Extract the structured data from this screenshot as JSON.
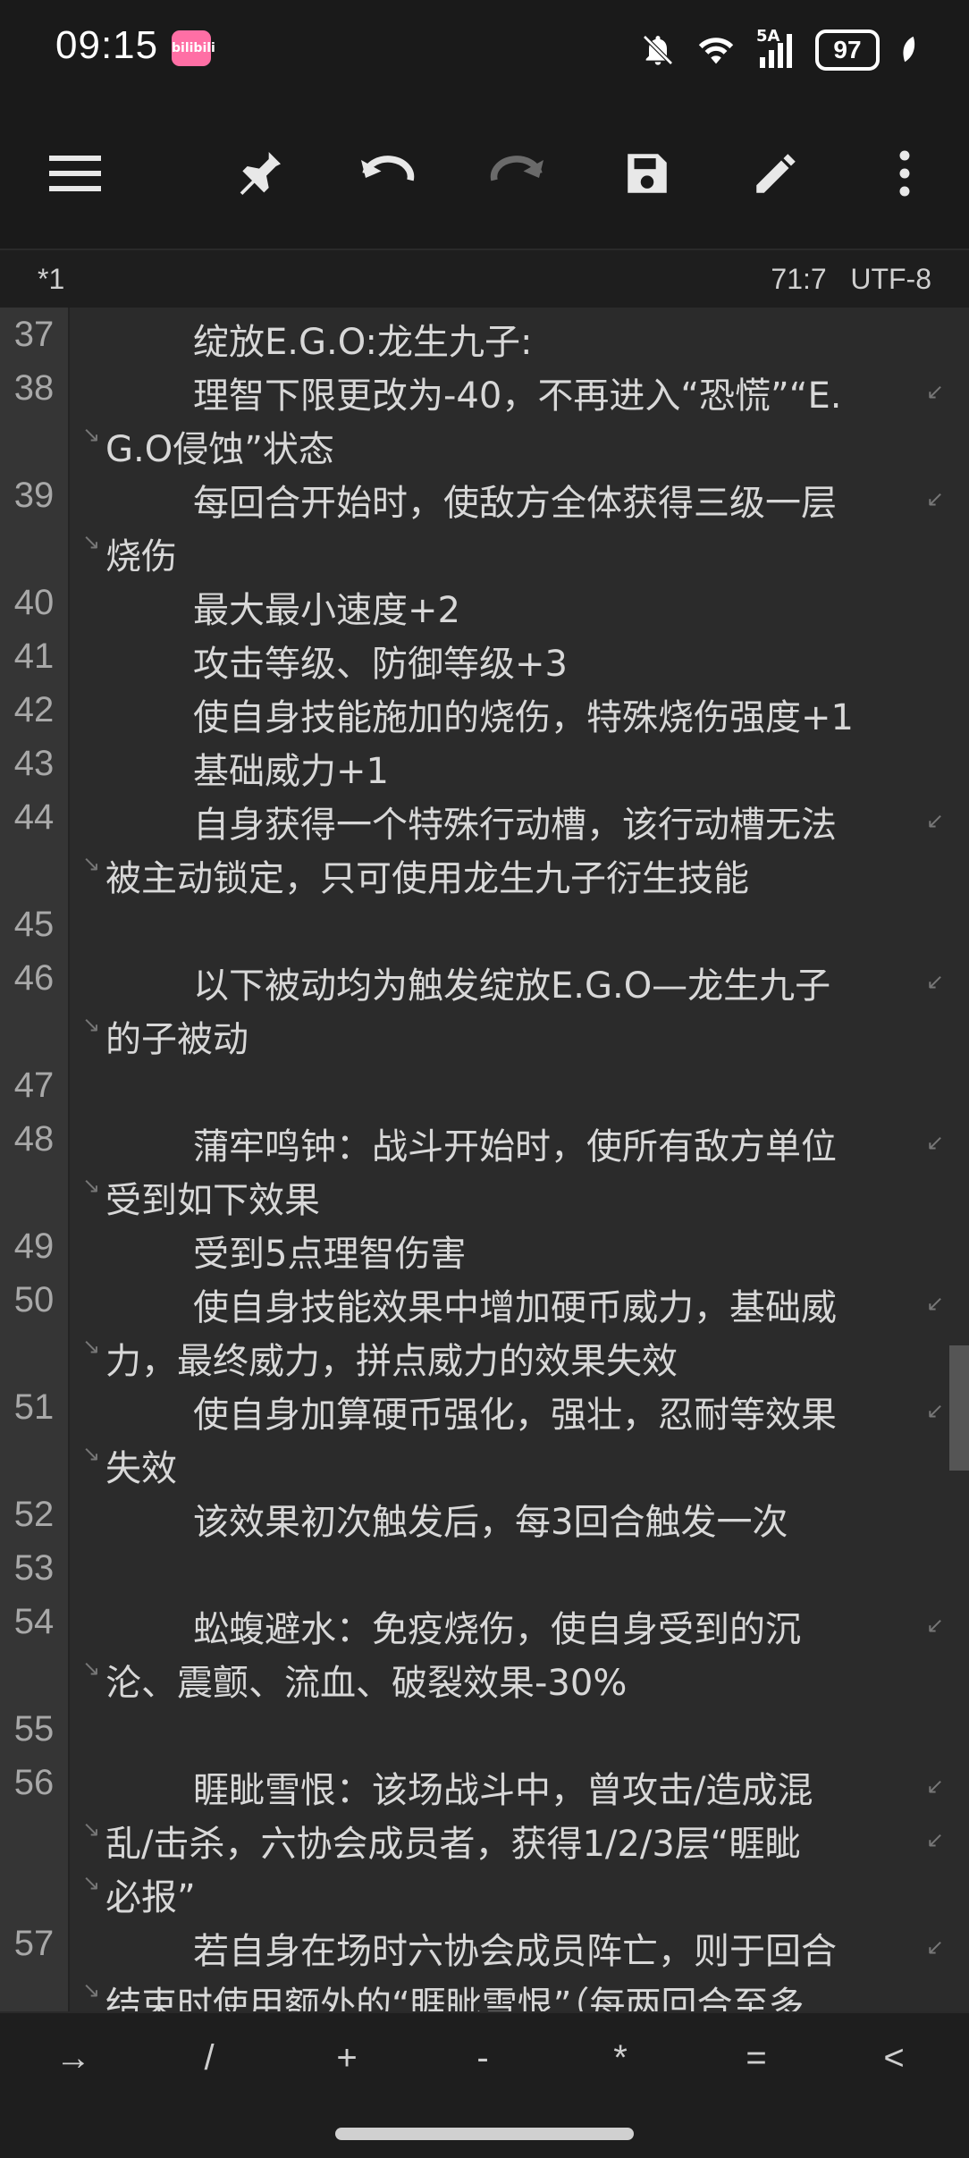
{
  "status_bar": {
    "time": "09:15",
    "app_badge": "bilibili",
    "network": "5A",
    "battery": "97"
  },
  "info_bar": {
    "file_name": "*1",
    "cursor_position": "71:7",
    "encoding": "UTF-8"
  },
  "editor_lines": [
    {
      "num": "37",
      "parts": [
        "绽放E.G.O:龙生九子:"
      ]
    },
    {
      "num": "38",
      "parts": [
        "理智下限更改为-40，不再进入“恐慌”“E.",
        "G.O侵蚀”状态"
      ]
    },
    {
      "num": "39",
      "parts": [
        "每回合开始时，使敌方全体获得三级一层",
        "烧伤"
      ]
    },
    {
      "num": "40",
      "parts": [
        "最大最小速度+2"
      ]
    },
    {
      "num": "41",
      "parts": [
        "攻击等级、防御等级+3"
      ]
    },
    {
      "num": "42",
      "parts": [
        "使自身技能施加的烧伤，特殊烧伤强度+1"
      ]
    },
    {
      "num": "43",
      "parts": [
        "基础威力+1"
      ]
    },
    {
      "num": "44",
      "parts": [
        "自身获得一个特殊行动槽，该行动槽无法",
        "被主动锁定，只可使用龙生九子衍生技能"
      ]
    },
    {
      "num": "45",
      "parts": [
        ""
      ]
    },
    {
      "num": "46",
      "parts": [
        "以下被动均为触发绽放E.G.O—龙生九子",
        "的子被动"
      ]
    },
    {
      "num": "47",
      "parts": [
        ""
      ]
    },
    {
      "num": "48",
      "parts": [
        "蒲牢鸣钟：战斗开始时，使所有敌方单位",
        "受到如下效果"
      ]
    },
    {
      "num": "49",
      "parts": [
        "受到5点理智伤害"
      ]
    },
    {
      "num": "50",
      "parts": [
        "使自身技能效果中增加硬币威力，基础威",
        "力，最终威力，拼点威力的效果失效"
      ]
    },
    {
      "num": "51",
      "parts": [
        "使自身加算硬币强化，强壮，忍耐等效果",
        "失效"
      ]
    },
    {
      "num": "52",
      "parts": [
        "该效果初次触发后，每3回合触发一次"
      ]
    },
    {
      "num": "53",
      "parts": [
        ""
      ]
    },
    {
      "num": "54",
      "parts": [
        "蚣蝮避水：免疫烧伤，使自身受到的沉",
        "沦、震颤、流血、破裂效果-30%"
      ]
    },
    {
      "num": "55",
      "parts": [
        ""
      ]
    },
    {
      "num": "56",
      "parts": [
        "睚眦雪恨：该场战斗中，曾攻击/造成混",
        "乱/击杀，六协会成员者，获得1/2/3层“睚眦",
        "必报”"
      ]
    },
    {
      "num": "57",
      "parts": [
        "若自身在场时六协会成员阵亡，则于回合",
        "结束时使用额外的“睚眦雪恨”（每两回合至多"
      ]
    }
  ],
  "key_bar": {
    "keys": [
      "→",
      "/",
      "+",
      "-",
      "*",
      "=",
      "<"
    ]
  },
  "icons": {
    "menu": "menu-icon",
    "pin": "pin-icon",
    "undo": "undo-icon",
    "redo": "redo-icon",
    "save": "save-icon",
    "edit": "edit-icon",
    "more": "more-vert-icon"
  }
}
